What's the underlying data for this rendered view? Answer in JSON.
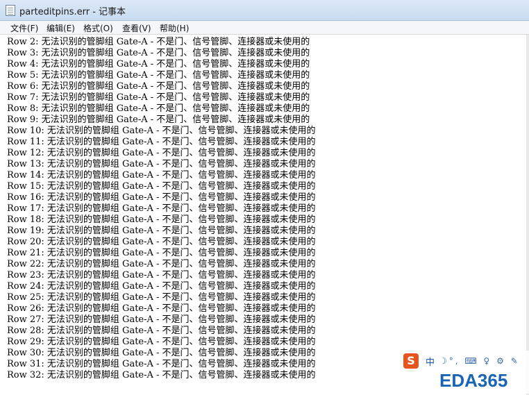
{
  "window": {
    "title": "parteditpins.err - 记事本"
  },
  "menu": [
    {
      "label": "文件(F)"
    },
    {
      "label": "编辑(E)"
    },
    {
      "label": "格式(O)"
    },
    {
      "label": "查看(V)"
    },
    {
      "label": "帮助(H)"
    }
  ],
  "editor": {
    "lines": [
      "Row 2: 无法识别的管脚组 Gate-A - 不是门、信号管脚、连接器或未使用的",
      "Row 3: 无法识别的管脚组 Gate-A - 不是门、信号管脚、连接器或未使用的",
      "Row 4: 无法识别的管脚组 Gate-A - 不是门、信号管脚、连接器或未使用的",
      "Row 5: 无法识别的管脚组 Gate-A - 不是门、信号管脚、连接器或未使用的",
      "Row 6: 无法识别的管脚组 Gate-A - 不是门、信号管脚、连接器或未使用的",
      "Row 7: 无法识别的管脚组 Gate-A - 不是门、信号管脚、连接器或未使用的",
      "Row 8: 无法识别的管脚组 Gate-A - 不是门、信号管脚、连接器或未使用的",
      "Row 9: 无法识别的管脚组 Gate-A - 不是门、信号管脚、连接器或未使用的",
      "Row 10: 无法识别的管脚组 Gate-A - 不是门、信号管脚、连接器或未使用的",
      "Row 11: 无法识别的管脚组 Gate-A - 不是门、信号管脚、连接器或未使用的",
      "Row 12: 无法识别的管脚组 Gate-A - 不是门、信号管脚、连接器或未使用的",
      "Row 13: 无法识别的管脚组 Gate-A - 不是门、信号管脚、连接器或未使用的",
      "Row 14: 无法识别的管脚组 Gate-A - 不是门、信号管脚、连接器或未使用的",
      "Row 15: 无法识别的管脚组 Gate-A - 不是门、信号管脚、连接器或未使用的",
      "Row 16: 无法识别的管脚组 Gate-A - 不是门、信号管脚、连接器或未使用的",
      "Row 17: 无法识别的管脚组 Gate-A - 不是门、信号管脚、连接器或未使用的",
      "Row 18: 无法识别的管脚组 Gate-A - 不是门、信号管脚、连接器或未使用的",
      "Row 19: 无法识别的管脚组 Gate-A - 不是门、信号管脚、连接器或未使用的",
      "Row 20: 无法识别的管脚组 Gate-A - 不是门、信号管脚、连接器或未使用的",
      "Row 21: 无法识别的管脚组 Gate-A - 不是门、信号管脚、连接器或未使用的",
      "Row 22: 无法识别的管脚组 Gate-A - 不是门、信号管脚、连接器或未使用的",
      "Row 23: 无法识别的管脚组 Gate-A - 不是门、信号管脚、连接器或未使用的",
      "Row 24: 无法识别的管脚组 Gate-A - 不是门、信号管脚、连接器或未使用的",
      "Row 25: 无法识别的管脚组 Gate-A - 不是门、信号管脚、连接器或未使用的",
      "Row 26: 无法识别的管脚组 Gate-A - 不是门、信号管脚、连接器或未使用的",
      "Row 27: 无法识别的管脚组 Gate-A - 不是门、信号管脚、连接器或未使用的",
      "Row 28: 无法识别的管脚组 Gate-A - 不是门、信号管脚、连接器或未使用的",
      "Row 29: 无法识别的管脚组 Gate-A - 不是门、信号管脚、连接器或未使用的",
      "Row 30: 无法识别的管脚组 Gate-A - 不是门、信号管脚、连接器或未使用的",
      "Row 31: 无法识别的管脚组 Gate-A - 不是门、信号管脚、连接器或未使用的",
      "Row 32: 无法识别的管脚组 Gate-A - 不是门、信号管脚、连接器或未使用的"
    ]
  },
  "watermark": {
    "toolbar_logo": "S",
    "toolbar_lang": "中",
    "toolbar_icons": "☽°, ⌨ ♀ ⚙ ✎",
    "brand": "EDA365"
  }
}
